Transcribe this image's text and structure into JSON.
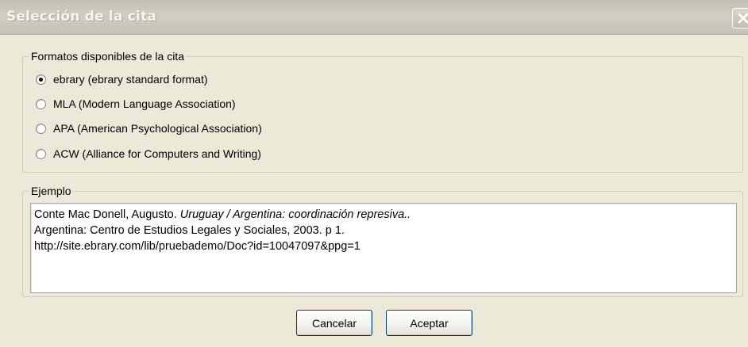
{
  "window": {
    "title": "Selección de la cita",
    "close_icon": "close-icon"
  },
  "formats": {
    "legend": "Formatos disponibles de la cita",
    "selected_index": 0,
    "options": [
      {
        "label": "ebrary  (ebrary standard format)"
      },
      {
        "label": "MLA  (Modern Language Association)"
      },
      {
        "label": "APA  (American Psychological Association)"
      },
      {
        "label": "ACW  (Alliance for Computers and Writing)"
      }
    ]
  },
  "example": {
    "legend": "Ejemplo",
    "line1_prefix": "Conte Mac Donell, Augusto. ",
    "line1_title": "Uruguay / Argentina: coordinación represiva..",
    "line2": "Argentina: Centro de Estudios Legales y Sociales, 2003. p 1.",
    "line3": "http://site.ebrary.com/lib/pruebademo/Doc?id=10047097&ppg=1"
  },
  "buttons": {
    "cancel_label": "Cancelar",
    "accept_label": "Aceptar"
  },
  "colors": {
    "dialog_bg": "#ece9d8",
    "button_border": "#003c74",
    "group_border": "#d0d0bf"
  }
}
